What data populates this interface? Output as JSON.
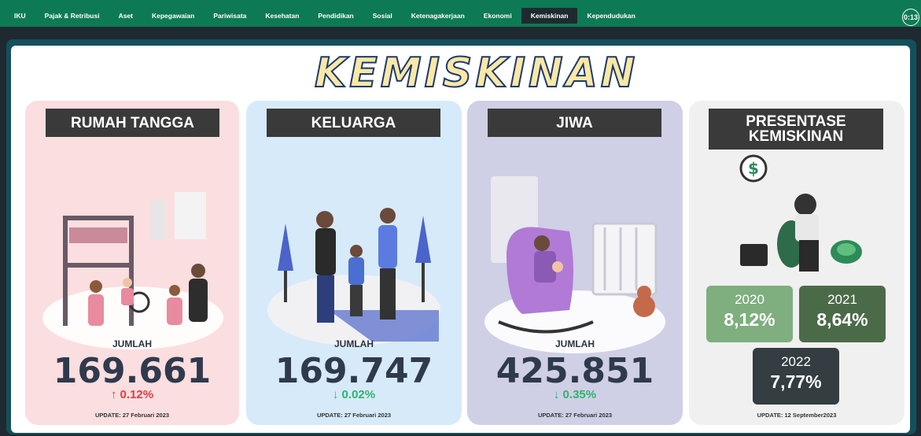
{
  "nav": {
    "tabs": [
      "IKU",
      "Pajak & Retribusi",
      "Aset",
      "Kepegawaian",
      "Pariwisata",
      "Kesehatan",
      "Pendidikan",
      "Sosial",
      "Ketenagakerjaan",
      "Ekonomi",
      "Kemiskinan",
      "Kependudukan"
    ],
    "active": "Kemiskinan"
  },
  "timer": "0:13",
  "title": "KEMISKINAN",
  "cards": [
    {
      "header": "RUMAH TANGGA",
      "label": "JUMLAH",
      "value": "169.661",
      "delta": "↑ 0.12%",
      "update": "UPDATE: 27 Februari 2023"
    },
    {
      "header": "KELUARGA",
      "label": "JUMLAH",
      "value": "169.747",
      "delta": "↓ 0.02%",
      "update": "UPDATE: 27 Februari 2023"
    },
    {
      "header": "JIWA",
      "label": "JUMLAH",
      "value": "425.851",
      "delta": "↓ 0.35%",
      "update": "UPDATE: 27 Februari 2023"
    }
  ],
  "persentase": {
    "header": "PRESENTASE KEMISKINAN",
    "years": [
      {
        "year": "2020",
        "value": "8,12%",
        "color": "#7fae7f"
      },
      {
        "year": "2021",
        "value": "8,64%",
        "color": "#4b6b48"
      },
      {
        "year": "2022",
        "value": "7,77%",
        "color": "#333d42"
      }
    ],
    "update": "UPDATE: 12 September2023"
  },
  "colors": {
    "topbar": "#0d7a55",
    "delta_up": "#e53b45",
    "delta_down": "#2fb36b"
  }
}
